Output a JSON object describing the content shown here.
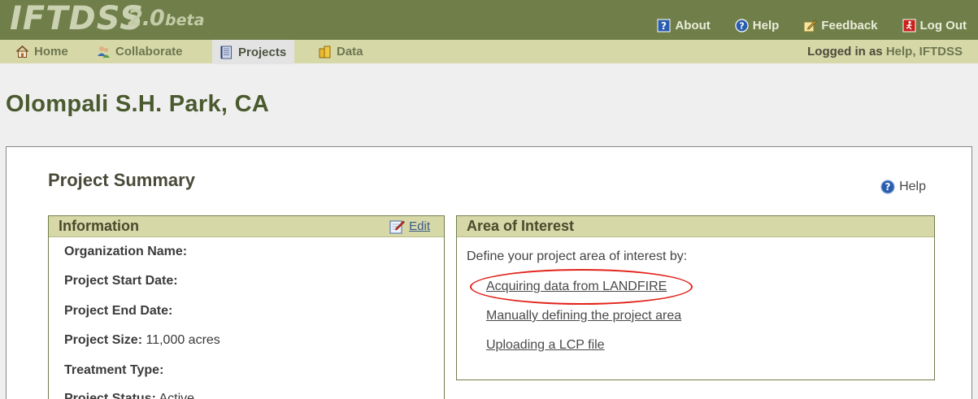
{
  "app": {
    "logo_main": "IFTDSS",
    "logo_version": "2.0",
    "logo_beta": "beta"
  },
  "toplinks": [
    {
      "label": "About",
      "icon": "question-box-icon"
    },
    {
      "label": "Help",
      "icon": "help-circle-icon"
    },
    {
      "label": "Feedback",
      "icon": "pencil-note-icon"
    },
    {
      "label": "Log Out",
      "icon": "exit-door-icon"
    }
  ],
  "nav": {
    "items": [
      {
        "label": "Home",
        "icon": "home-icon"
      },
      {
        "label": "Collaborate",
        "icon": "users-icon"
      },
      {
        "label": "Projects",
        "icon": "notebook-icon",
        "active": true
      },
      {
        "label": "Data",
        "icon": "data-stack-icon"
      }
    ],
    "logged_prefix": "Logged in as",
    "logged_user": "Help, IFTDSS"
  },
  "page": {
    "title": "Olompali S.H. Park, CA"
  },
  "summary": {
    "title": "Project Summary",
    "help_label": "Help"
  },
  "information": {
    "title": "Information",
    "edit_label": "Edit",
    "fields": [
      {
        "label": "Organization Name:",
        "value": ""
      },
      {
        "label": "Project Start Date:",
        "value": ""
      },
      {
        "label": "Project End Date:",
        "value": ""
      },
      {
        "label": "Project Size:",
        "value": "11,000 acres"
      },
      {
        "label": "Treatment Type:",
        "value": ""
      },
      {
        "label": "Project Status:",
        "value": "Active"
      }
    ]
  },
  "aoi": {
    "title": "Area of Interest",
    "intro": "Define your project area of interest by:",
    "links": [
      "Acquiring data from LANDFIRE",
      "Manually defining the project area",
      "Uploading a LCP file"
    ]
  },
  "colors": {
    "header": "#707e4a",
    "nav": "#d6d8a8",
    "highlight": "#e2231a"
  }
}
